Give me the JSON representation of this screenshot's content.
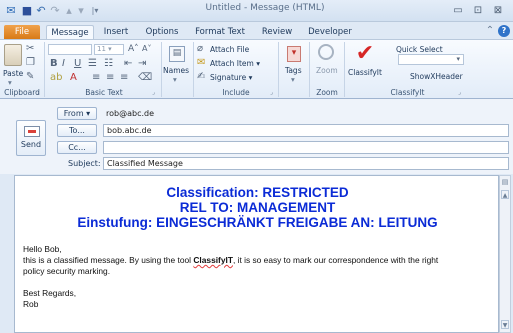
{
  "window": {
    "title": "Untitled - Message (HTML)",
    "icons": [
      "outlook-icon",
      "save-icon",
      "undo-icon",
      "redo-icon",
      "up-arrow-icon",
      "down-arrow-icon",
      "customize-icon"
    ],
    "controls": {
      "minimize": "▭",
      "maximize": "⊡",
      "close": "⊠"
    }
  },
  "tabs": [
    {
      "label": "File",
      "active": false
    },
    {
      "label": "Message",
      "active": true
    },
    {
      "label": "Insert",
      "active": false
    },
    {
      "label": "Options",
      "active": false
    },
    {
      "label": "Format Text",
      "active": false
    },
    {
      "label": "Review",
      "active": false
    },
    {
      "label": "Developer",
      "active": false
    }
  ],
  "ribbon": {
    "clipboard": {
      "paste_label": "Paste",
      "group_label": "Clipboard"
    },
    "basic_text": {
      "font_size": "11",
      "bold": "B",
      "italic": "I",
      "underline": "U",
      "group_label": "Basic Text"
    },
    "names": {
      "label": "Names"
    },
    "include": {
      "attach_file": "Attach File",
      "attach_item": "Attach Item",
      "signature": "Signature",
      "group_label": "Include"
    },
    "tags": {
      "label": "Tags"
    },
    "zoom": {
      "label": "Zoom",
      "group_label": "Zoom"
    },
    "classifyit": {
      "classifyit_label": "ClassifyIt",
      "quick_select": "Quick Select",
      "show_xheader": "ShowXHeader",
      "group_label": "ClassifyIt"
    }
  },
  "header": {
    "send_label": "Send",
    "from_label": "From",
    "from_value": "rob@abc.de",
    "to_label": "To...",
    "to_value": "bob.abc.de",
    "cc_label": "Cc...",
    "cc_value": "",
    "subject_label": "Subject:",
    "subject_value": "Classified Message"
  },
  "body": {
    "classification_lines": [
      "Classification: RESTRICTED",
      "REL TO: MANAGEMENT",
      "Einstufung: EINGESCHRÄNKT FREIGABE AN: LEITUNG"
    ],
    "greeting": "Hello Bob,",
    "line1_before": "this is a classified message. By using the tool ",
    "line1_tool": "ClassifyIT",
    "line1_after": ", it is so easy to mark our correspondence with the right",
    "line2": "policy security marking.",
    "closing": "Best Regards,",
    "signature": "Rob"
  },
  "colors": {
    "classification_text": "#0b2bd6",
    "file_tab": "#e08421",
    "ribbon_bg": "#e2ecf8"
  }
}
